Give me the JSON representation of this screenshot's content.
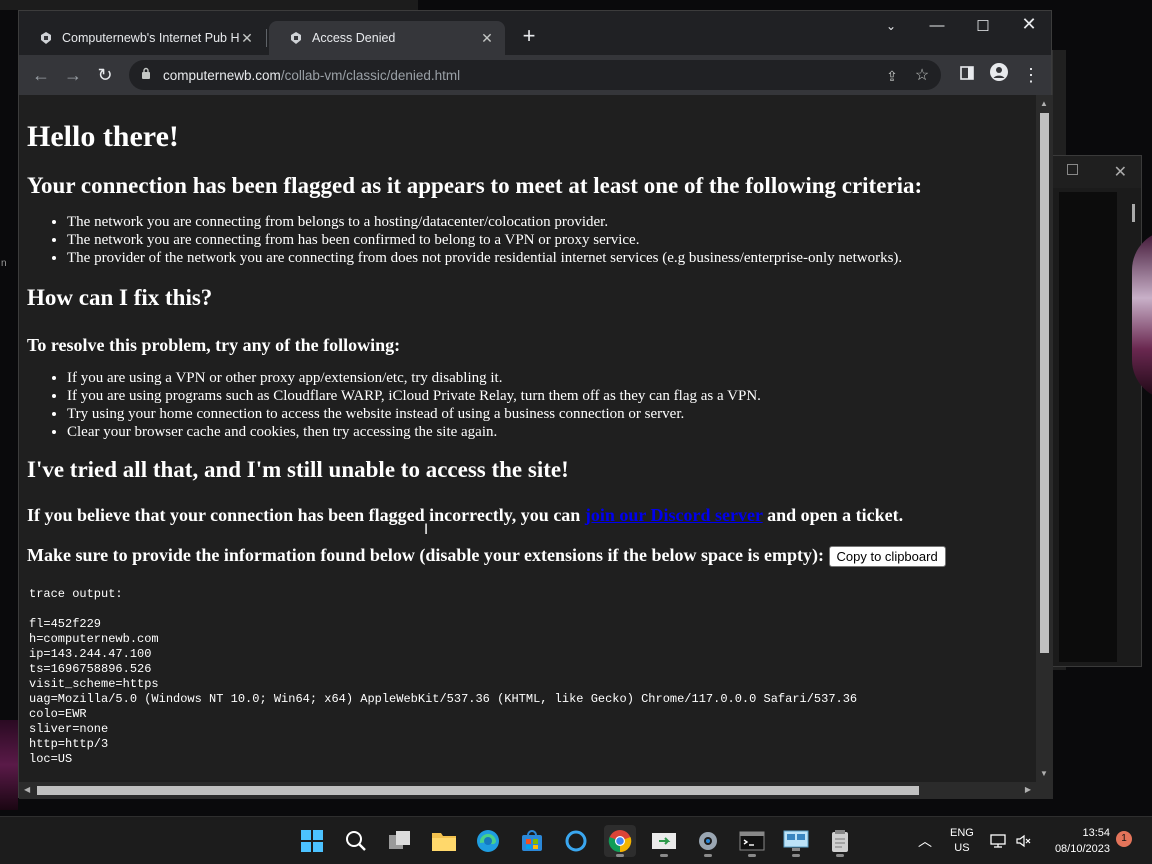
{
  "browser": {
    "tabs": [
      {
        "title": "Computernewb's Internet Pub H",
        "active": false
      },
      {
        "title": "Access Denied",
        "active": true
      }
    ],
    "new_tab_label": "+",
    "url_host": "computernewb.com",
    "url_path": "/collab-vm/classic/denied.html"
  },
  "page": {
    "heading": "Hello there!",
    "criteria_heading": "Your connection has been flagged as it appears to meet at least one of the following criteria:",
    "criteria": [
      "The network you are connecting from belongs to a hosting/datacenter/colocation provider.",
      "The network you are connecting from has been confirmed to belong to a VPN or proxy service.",
      "The provider of the network you are connecting from does not provide residential internet services (e.g business/enterprise-only networks)."
    ],
    "fix_heading": "How can I fix this?",
    "fix_subheading": "To resolve this problem, try any of the following:",
    "fixes": [
      "If you are using a VPN or other proxy app/extension/etc, try disabling it.",
      "If you are using programs such as Cloudflare WARP, iCloud Private Relay, turn them off as they can flag as a VPN.",
      "Try using your home connection to access the website instead of using a business connection or server.",
      "Clear your browser cache and cookies, then try accessing the site again."
    ],
    "tried_heading": "I've tried all that, and I'm still unable to access the site!",
    "incorrect_prefix": "If you believe that your connection has been flagged incorrectly, you can ",
    "discord_link": "join our Discord server",
    "incorrect_suffix": " and open a ticket.",
    "provide_text": "Make sure to provide the information found below (disable your extensions if the below space is empty): ",
    "copy_button": "Copy to clipboard",
    "trace_lines": [
      "trace output:",
      "",
      "fl=452f229",
      "h=computernewb.com",
      "ip=143.244.47.100",
      "ts=1696758896.526",
      "visit_scheme=https",
      "uag=Mozilla/5.0 (Windows NT 10.0; Win64; x64) AppleWebKit/537.36 (KHTML, like Gecko) Chrome/117.0.0.0 Safari/537.36",
      "colo=EWR",
      "sliver=none",
      "http=http/3",
      "loc=US"
    ]
  },
  "taskbar": {
    "apps": [
      "start-icon",
      "search-icon",
      "task-view-icon",
      "file-explorer-icon",
      "edge-icon",
      "store-icon",
      "cortana-icon",
      "chrome-icon",
      "remote-app-icon",
      "settings-icon",
      "terminal-icon",
      "network-app-icon",
      "notepad-icon"
    ],
    "lang_top": "ENG",
    "lang_bottom": "US",
    "time": "13:54",
    "date": "08/10/2023",
    "notification_count": "1"
  },
  "colors": {
    "page_bg": "#1f1f1f",
    "link": "#0000ee",
    "tab_active": "#35363a",
    "tabstrip": "#202124"
  }
}
